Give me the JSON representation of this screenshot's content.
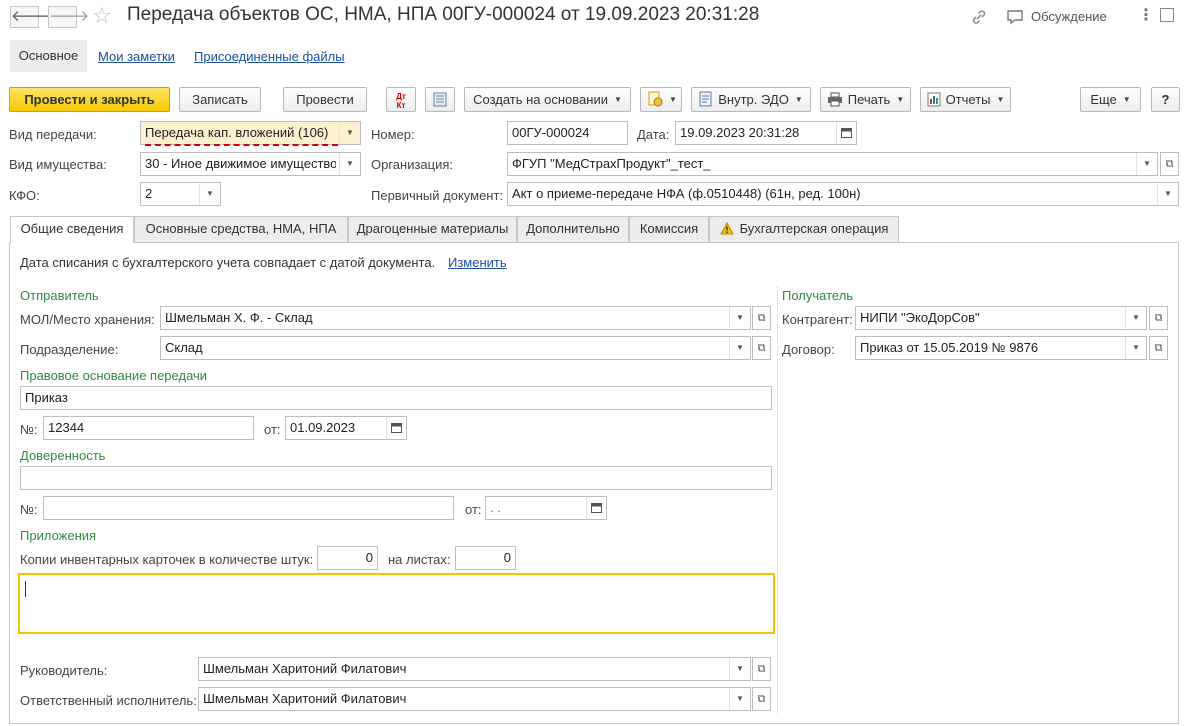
{
  "header": {
    "title": "Передача объектов ОС, НМА, НПА 00ГУ-000024 от 19.09.2023 20:31:28",
    "discussion_label": "Обсуждение"
  },
  "nav_tabs": [
    {
      "label": "Основное"
    },
    {
      "label": "Мои заметки"
    },
    {
      "label": "Присоединенные файлы"
    }
  ],
  "toolbar": {
    "post_close": "Провести и закрыть",
    "save": "Записать",
    "post": "Провести",
    "create_based": "Создать на основании",
    "edo": "Внутр. ЭДО",
    "print": "Печать",
    "reports": "Отчеты",
    "more": "Еще",
    "help": "?"
  },
  "header_fields": {
    "transfer_type_label": "Вид передачи:",
    "transfer_type_value": "Передача кап. вложений (106)",
    "property_type_label": "Вид имущества:",
    "property_type_value": "30 - Иное движимое имущество",
    "kfo_label": "КФО:",
    "kfo_value": "2",
    "number_label": "Номер:",
    "number_value": "00ГУ-000024",
    "date_label": "Дата:",
    "date_value": "19.09.2023 20:31:28",
    "org_label": "Организация:",
    "org_value": "ФГУП \"МедСтрахПродукт\"_тест_",
    "primary_doc_label": "Первичный документ:",
    "primary_doc_value": "Акт о приеме-передаче НФА (ф.0510448) (61н, ред. 100н)"
  },
  "tabs": [
    {
      "label": "Общие сведения",
      "active": true
    },
    {
      "label": "Основные средства, НМА, НПА"
    },
    {
      "label": "Драгоценные материалы"
    },
    {
      "label": "Дополнительно"
    },
    {
      "label": "Комиссия"
    },
    {
      "label": "Бухгалтерская операция",
      "warning": true
    }
  ],
  "general": {
    "write_off_note": "Дата списания с бухгалтерского учета совпадает с датой документа.",
    "change_link": "Изменить",
    "sender_heading": "Отправитель",
    "mol_label": "МОЛ/Место хранения:",
    "mol_value": "Шмельман Х. Ф. - Склад",
    "dept_label": "Подразделение:",
    "dept_value": "Склад",
    "legal_basis_heading": "Правовое основание передачи",
    "legal_basis_value": "Приказ",
    "order_no_label": "№:",
    "order_no_value": "12344",
    "order_date_label": "от:",
    "order_date_value": "01.09.2023",
    "power_heading": "Доверенность",
    "power_value": "",
    "power_no_label": "№:",
    "power_no_value": "",
    "power_date_label": "от:",
    "power_date_value": " .  .",
    "attachments_heading": "Приложения",
    "cards_label": "Копии инвентарных карточек в количестве штук:",
    "cards_value": "0",
    "sheets_label": "на листах:",
    "sheets_value": "0",
    "comment_value": "",
    "recipient_heading": "Получатель",
    "contractor_label": "Контрагент:",
    "contractor_value": "НИПИ \"ЭкоДорСов\"",
    "contract_label": "Договор:",
    "contract_value": "Приказ от 15.05.2019 № 9876",
    "head_label": "Руководитель:",
    "head_value": "Шмельман Харитоний Филатович",
    "executor_label": "Ответственный исполнитель:",
    "executor_value": "Шмельман Харитоний Филатович"
  },
  "colors": {
    "accent_yellow": "#f5c900",
    "section_green": "#2e8b3e",
    "link_blue": "#1a4fa0",
    "error_underline": "#d40000"
  },
  "icons": [
    "back-arrow-icon",
    "forward-arrow-icon",
    "star-icon",
    "link-icon",
    "discussion-icon",
    "kebab-icon",
    "maximize-icon",
    "close-icon",
    "dt-kt-icon",
    "list-icon",
    "create-based-icon",
    "edo-icon",
    "printer-icon",
    "reports-icon",
    "calendar-icon",
    "warning-icon"
  ]
}
